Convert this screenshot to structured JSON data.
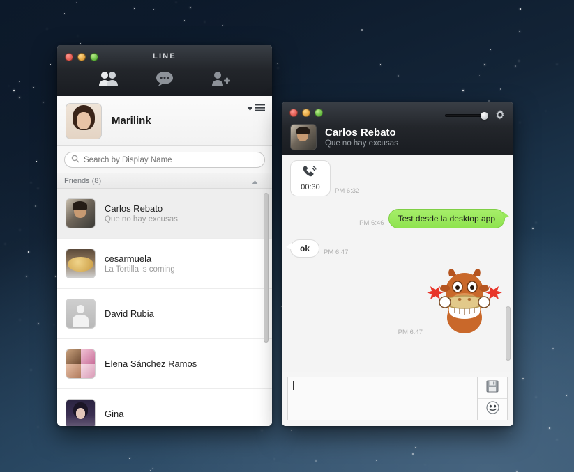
{
  "desktop": {
    "wallpaper_name": "starfield-wallpaper"
  },
  "line_window": {
    "title": "LINE",
    "traffic_lights": [
      "close",
      "minimize",
      "zoom"
    ],
    "toolbar": [
      {
        "name": "friends-tab",
        "icon": "two-people-icon",
        "active": true
      },
      {
        "name": "chats-tab",
        "icon": "chat-bubble-icon",
        "active": false
      },
      {
        "name": "add-friend-tab",
        "icon": "person-plus-icon",
        "active": false
      }
    ],
    "profile": {
      "name": "Marilink",
      "avatar": "marilink-avatar",
      "menu_icon": "list-menu-icon",
      "caret_icon": "chevron-down-icon"
    },
    "search": {
      "placeholder": "Search by Display Name",
      "value": "",
      "icon": "search-icon"
    },
    "friends_section": {
      "label": "Friends (8)",
      "count": 8,
      "collapse_icon": "chevron-up-icon"
    },
    "friends": [
      {
        "name": "Carlos Rebato",
        "status": "Que no hay excusas",
        "avatar": "carlos-avatar",
        "selected": true
      },
      {
        "name": "cesarmuela",
        "status": "La Tortilla is coming",
        "avatar": "tortilla-avatar",
        "selected": false
      },
      {
        "name": "David Rubia",
        "status": "",
        "avatar": "default-avatar",
        "selected": false
      },
      {
        "name": "Elena Sánchez Ramos",
        "status": "",
        "avatar": "elena-avatar",
        "selected": false
      },
      {
        "name": "Gina",
        "status": "",
        "avatar": "gina-avatar",
        "selected": false
      }
    ]
  },
  "chat_window": {
    "peer": {
      "name": "Carlos Rebato",
      "status": "Que no hay excusas",
      "avatar": "carlos-avatar"
    },
    "traffic_lights": [
      "close",
      "minimize",
      "zoom"
    ],
    "slider": {
      "name": "volume-slider",
      "value": 100
    },
    "gear_icon": "gear-icon",
    "messages": [
      {
        "type": "call",
        "duration": "00:30",
        "time": "PM 6:32",
        "direction": "in",
        "icon": "phone-call-icon"
      },
      {
        "type": "text",
        "text": "Test desde la desktop app",
        "time": "PM 6:46",
        "direction": "out"
      },
      {
        "type": "text",
        "text": "ok",
        "time": "PM 6:47",
        "direction": "in"
      },
      {
        "type": "sticker",
        "sticker": "brown-cow-tortilla-sticker",
        "time": "PM 6:47",
        "direction": "out"
      }
    ],
    "input": {
      "value": "",
      "placeholder": ""
    },
    "actions": [
      {
        "name": "save-button",
        "icon": "floppy-disk-icon"
      },
      {
        "name": "sticker-button",
        "icon": "smiley-face-icon"
      }
    ]
  },
  "colors": {
    "outgoing_bubble": "#98e75c",
    "titlebar_dark": "#23262b",
    "selected_row": "#eeeeee",
    "chat_background": "#f4f4f4"
  }
}
